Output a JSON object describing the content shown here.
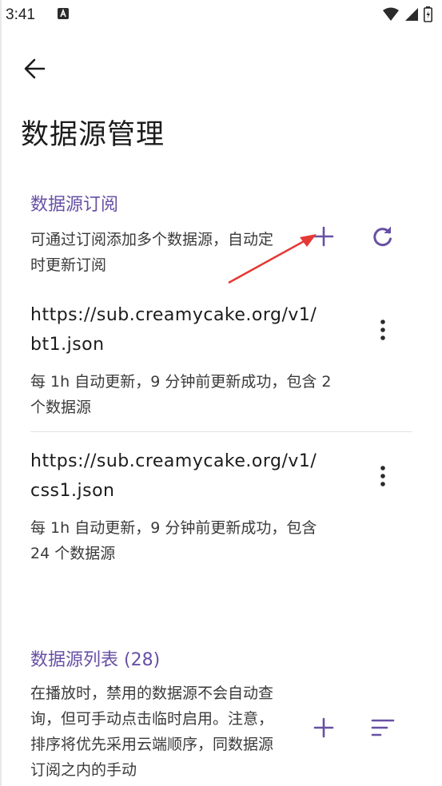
{
  "status_bar": {
    "time": "3:41",
    "icons": [
      "notification-icon",
      "wifi-icon",
      "signal-icon",
      "battery-icon"
    ]
  },
  "header": {
    "back_icon": "arrow-back-icon",
    "title": "数据源管理"
  },
  "subscriptions": {
    "title": "数据源订阅",
    "description": "可通过订阅添加多个数据源，自动定时更新订阅",
    "add_icon": "plus-icon",
    "refresh_icon": "refresh-icon",
    "items": [
      {
        "url": "https://sub.creamycake.org/v1/bt1.json",
        "status": "每 1h 自动更新，9 分钟前更新成功，包含 2 个数据源"
      },
      {
        "url": "https://sub.creamycake.org/v1/css1.json",
        "status": "每 1h 自动更新，9 分钟前更新成功，包含 24 个数据源"
      }
    ]
  },
  "source_list": {
    "title": "数据源列表 (28)",
    "description": "在播放时，禁用的数据源不会自动查询，但可手动点击临时启用。注意，排序将优先采用云端顺序，同数据源订阅之内的手动",
    "add_icon": "plus-icon",
    "sort_icon": "sort-icon"
  },
  "colors": {
    "accent": "#6750a4",
    "annotation_arrow": "#e53935"
  }
}
